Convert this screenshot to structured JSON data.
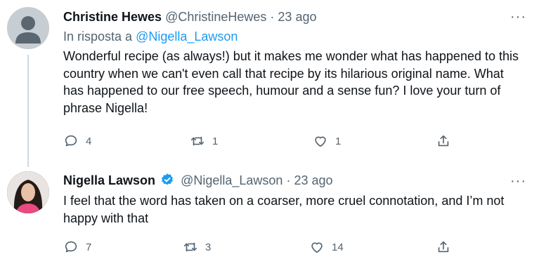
{
  "tweets": [
    {
      "name": "Christine Hewes",
      "handle": "@ChristineHewes",
      "separator": "·",
      "time": "23 ago",
      "more": "···",
      "reply_prefix": "In risposta a",
      "reply_handle": "@Nigella_Lawson",
      "text": "Wonderful recipe (as always!) but it makes me wonder what has happened to this country when we can't even call that recipe by its hilarious original name. What has happened to our free speech, humour and a sense fun? I love your turn of phrase Nigella!",
      "replies": "4",
      "retweets": "1",
      "likes": "1"
    },
    {
      "name": "Nigella Lawson",
      "handle": "@Nigella_Lawson",
      "separator": "·",
      "time": "23 ago",
      "more": "···",
      "verified": true,
      "text": "I feel that the word has taken on a coarser, more cruel connotation, and I’m not happy with that",
      "replies": "7",
      "retweets": "3",
      "likes": "14"
    }
  ],
  "colors": {
    "accent": "#1d9bf0",
    "muted": "#536471",
    "text": "#0f1419",
    "thread_line": "#cfd9de"
  },
  "icons": [
    "reply-icon",
    "retweet-icon",
    "like-icon",
    "share-icon",
    "more-icon",
    "verified-badge-icon"
  ]
}
